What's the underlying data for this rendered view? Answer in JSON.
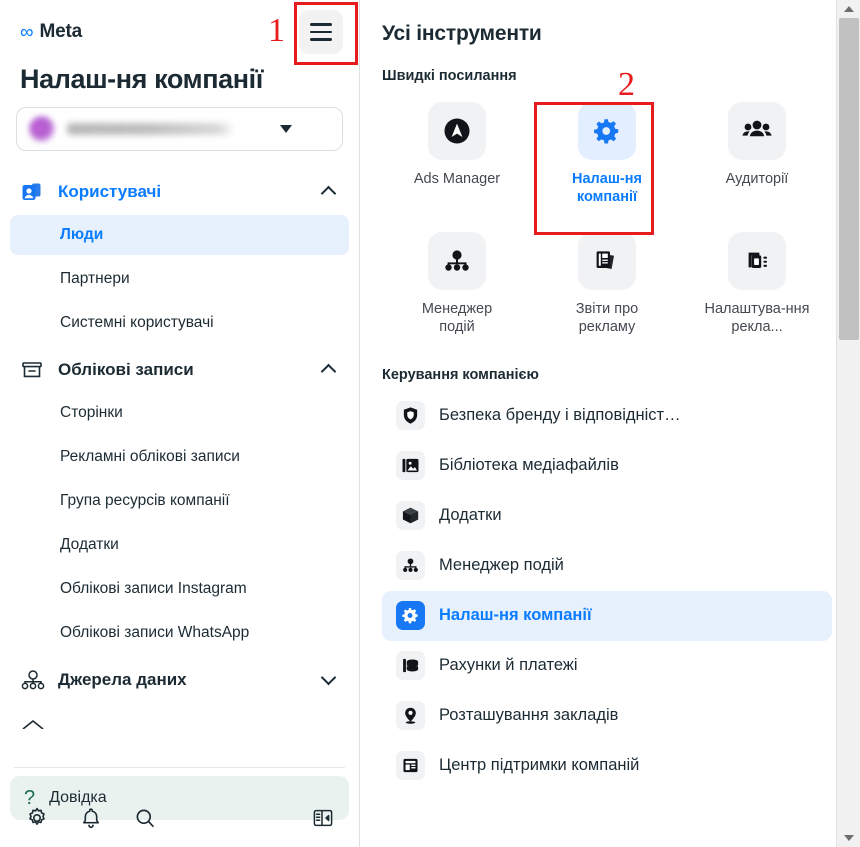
{
  "sidebar": {
    "brand": {
      "logo_icon": "meta-infinity-logo",
      "name": "Meta"
    },
    "menu_button_icon": "hamburger-menu-icon",
    "page_title": "Налаш-ня компанії",
    "account_selector": {
      "avatar_icon": "account-avatar",
      "value": "",
      "caret_icon": "chevron-down-icon"
    },
    "groups": [
      {
        "label": "Користувачі",
        "icon": "users-id-card-icon",
        "expanded": true,
        "chevron": "chevron-up-icon",
        "active": true,
        "items": [
          {
            "label": "Люди",
            "selected": true
          },
          {
            "label": "Партнери",
            "selected": false
          },
          {
            "label": "Системні користувачі",
            "selected": false
          }
        ]
      },
      {
        "label": "Облікові записи",
        "icon": "accounts-box-icon",
        "expanded": true,
        "chevron": "chevron-up-icon",
        "active": false,
        "items": [
          {
            "label": "Сторінки",
            "selected": false
          },
          {
            "label": "Рекламні облікові записи",
            "selected": false
          },
          {
            "label": "Група ресурсів компанії",
            "selected": false
          },
          {
            "label": "Додатки",
            "selected": false
          },
          {
            "label": "Облікові записи Instagram",
            "selected": false
          },
          {
            "label": "Облікові записи WhatsApp",
            "selected": false
          }
        ]
      },
      {
        "label": "Джерела даних",
        "icon": "data-sources-icon",
        "expanded": false,
        "chevron": "chevron-down-icon",
        "active": false,
        "items": []
      }
    ],
    "help": {
      "icon": "question-mark-icon",
      "label": "Довідка"
    },
    "bottom_icons": [
      {
        "name": "settings-gear-icon"
      },
      {
        "name": "notifications-bell-icon"
      },
      {
        "name": "search-icon"
      },
      {
        "name": "collapse-panel-icon"
      }
    ]
  },
  "content": {
    "title": "Усі інструменти",
    "quick_links_heading": "Швидкі посилання",
    "tiles": [
      {
        "label": "Ads Manager",
        "icon": "ads-manager-icon",
        "active": false
      },
      {
        "label": "Налаш-ня компанії",
        "icon": "gear-icon",
        "active": true
      },
      {
        "label": "Аудиторії",
        "icon": "audiences-people-icon",
        "active": false
      },
      {
        "label": "Менеджер подій",
        "icon": "events-manager-icon",
        "active": false
      },
      {
        "label": "Звіти про рекламу",
        "icon": "ads-reporting-icon",
        "active": false
      },
      {
        "label": "Налаштува-ння рекла...",
        "icon": "ad-settings-icon",
        "active": false
      }
    ],
    "manage_heading": "Керування компанією",
    "manage_items": [
      {
        "label": "Безпека бренду і відповідніст…",
        "icon": "shield-icon",
        "selected": false
      },
      {
        "label": "Бібліотека медіафайлів",
        "icon": "media-library-icon",
        "selected": false
      },
      {
        "label": "Додатки",
        "icon": "apps-cube-icon",
        "selected": false
      },
      {
        "label": "Менеджер подій",
        "icon": "events-manager-icon",
        "selected": false
      },
      {
        "label": "Налаш-ня компанії",
        "icon": "gear-icon",
        "selected": true
      },
      {
        "label": "Рахунки й платежі",
        "icon": "billing-icon",
        "selected": false
      },
      {
        "label": "Розташування закладів",
        "icon": "location-pin-icon",
        "selected": false
      },
      {
        "label": "Центр підтримки компаній",
        "icon": "support-center-icon",
        "selected": false
      }
    ]
  },
  "scrollbar": {
    "up_arrow_icon": "scroll-up-arrow",
    "down_arrow_icon": "scroll-down-arrow"
  },
  "annotations": [
    {
      "number": "1",
      "target": "hamburger-menu-button"
    },
    {
      "number": "2",
      "target": "business-settings-tile"
    }
  ],
  "colors": {
    "accent_blue": "#0a7cff",
    "badge_blue": "#1877f2",
    "highlight_bg": "#e7f0fd",
    "annotation_red": "#e81c1c",
    "help_bg": "#e9f2ee"
  }
}
